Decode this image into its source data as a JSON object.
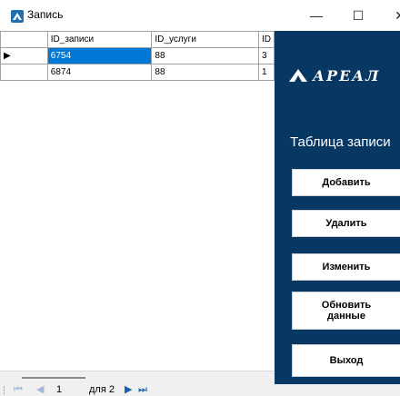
{
  "window": {
    "title": "Запись",
    "minimize_glyph": "—",
    "maximize_glyph": "☐",
    "close_glyph": "✕",
    "icon": "app-logo-icon"
  },
  "grid": {
    "columns": [
      "ID_записи",
      "ID_услуги",
      "ID"
    ],
    "rows": [
      {
        "indicator": "▶",
        "cells": [
          "6754",
          "88",
          "3"
        ],
        "selected": true
      },
      {
        "indicator": "",
        "cells": [
          "6874",
          "88",
          "1"
        ],
        "selected": false
      }
    ],
    "selection_color": "#0078d7"
  },
  "navigator": {
    "first_glyph": "⏮",
    "prev_glyph": "◀",
    "position": "1",
    "count_text": "для 2",
    "next_glyph": "▶",
    "last_glyph": "⏭"
  },
  "panel": {
    "background": "#073763",
    "logo_text": "АРЕАЛ",
    "title": "Таблица записи",
    "buttons": {
      "add": "Добавить",
      "delete": "Удалить",
      "edit": "Изменить",
      "refresh_line1": "Обновить",
      "refresh_line2": "данные",
      "exit": "Выход"
    }
  }
}
